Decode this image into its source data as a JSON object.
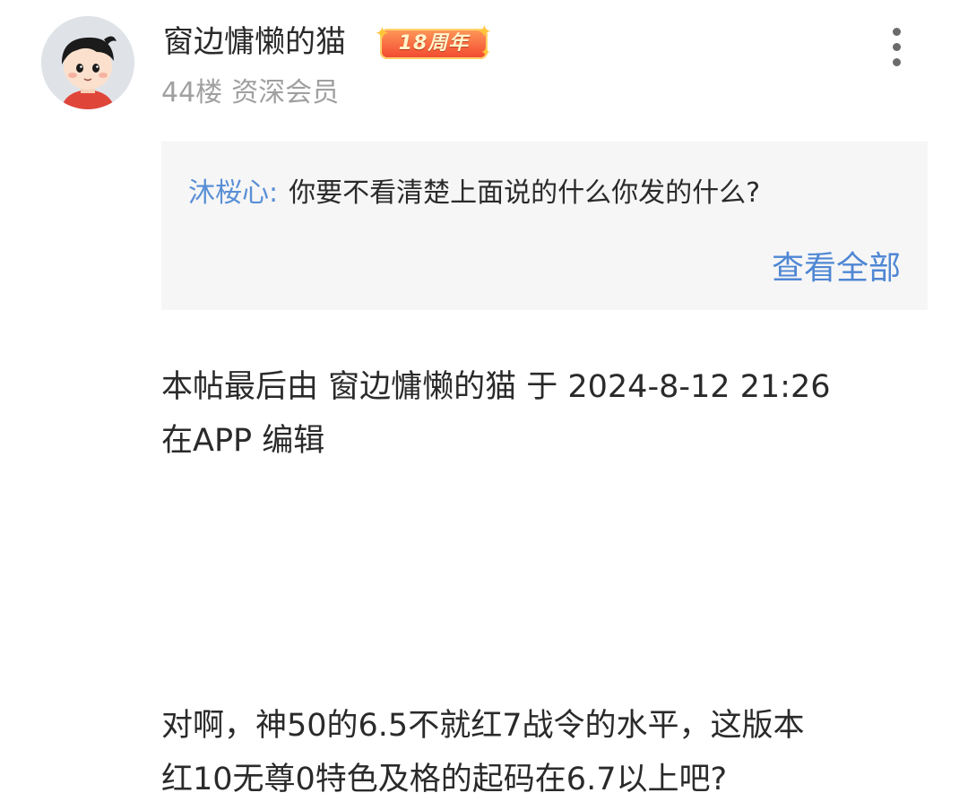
{
  "post": {
    "author": {
      "username": "窗边慵懒的猫",
      "badge_label": "18周年",
      "floor": "44楼",
      "rank": "资深会员"
    },
    "quote": {
      "author": "沐桜心:",
      "text": "你要不看清楚上面说的什么你发的什么?",
      "view_all_label": "查看全部"
    },
    "edit_note": {
      "line1": "本帖最后由 窗边慵懒的猫 于 2024-8-12 21:26",
      "line2": "在APP 编辑"
    },
    "content": {
      "line1": "对啊，神50的6.5不就红7战令的水平，这版本",
      "line2": "红10无尊0特色及格的起码在6.7以上吧?"
    }
  },
  "icons": {
    "more": "more-vertical-icon",
    "badge_stars": "sparkle-star-icon"
  },
  "colors": {
    "link_blue": "#4f87d4",
    "meta_gray": "#a0a0a0",
    "quote_bg": "#f6f6f6",
    "badge_red": "#f2462e"
  }
}
